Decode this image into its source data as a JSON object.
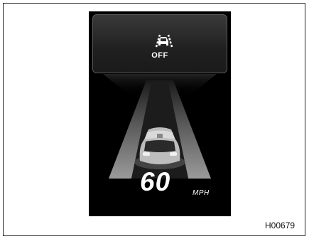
{
  "display": {
    "assist_status": "OFF",
    "assist_icon": "lane-keep-assist-icon",
    "speed_value": "60",
    "speed_unit": "MPH"
  },
  "figure_id": "H00679",
  "colors": {
    "display_background": "#000000",
    "text": "#ffffff",
    "lane": "#8a8a8a"
  }
}
